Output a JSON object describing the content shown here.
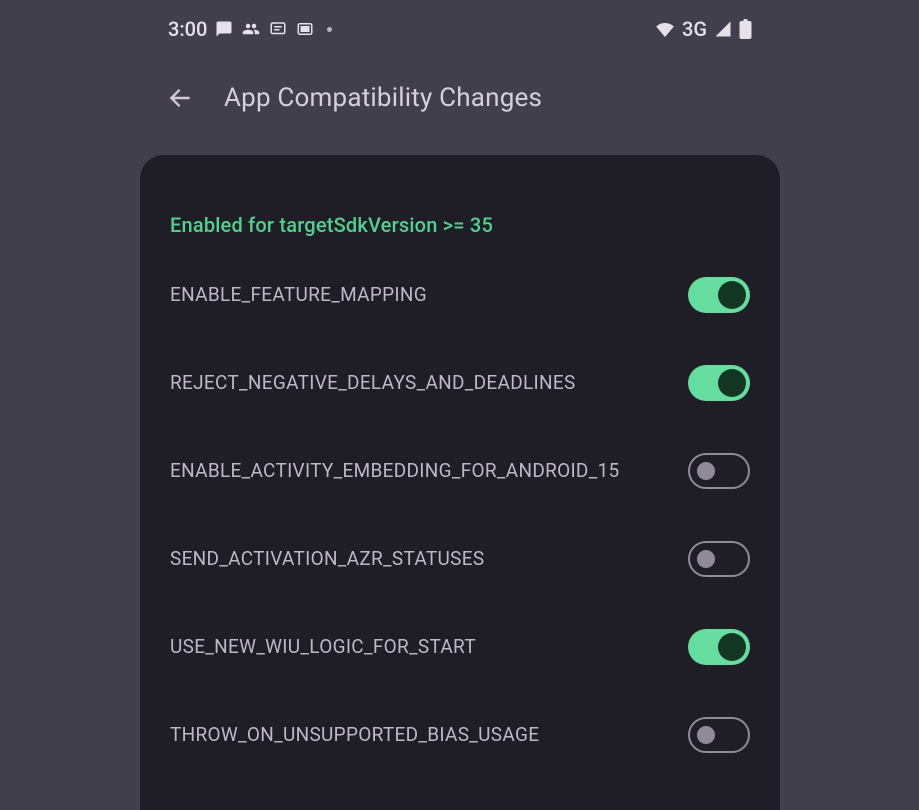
{
  "status_bar": {
    "time": "3:00",
    "network_label": "3G"
  },
  "header": {
    "title": "App Compatibility Changes"
  },
  "section": {
    "label": "Enabled for targetSdkVersion >= 35"
  },
  "settings": [
    {
      "label": "ENABLE_FEATURE_MAPPING",
      "enabled": true
    },
    {
      "label": "REJECT_NEGATIVE_DELAYS_AND_DEADLINES",
      "enabled": true
    },
    {
      "label": "ENABLE_ACTIVITY_EMBEDDING_FOR_ANDROID_15",
      "enabled": false
    },
    {
      "label": "SEND_ACTIVATION_AZR_STATUSES",
      "enabled": false
    },
    {
      "label": "USE_NEW_WIU_LOGIC_FOR_START",
      "enabled": true
    },
    {
      "label": "THROW_ON_UNSUPPORTED_BIAS_USAGE",
      "enabled": false
    }
  ]
}
